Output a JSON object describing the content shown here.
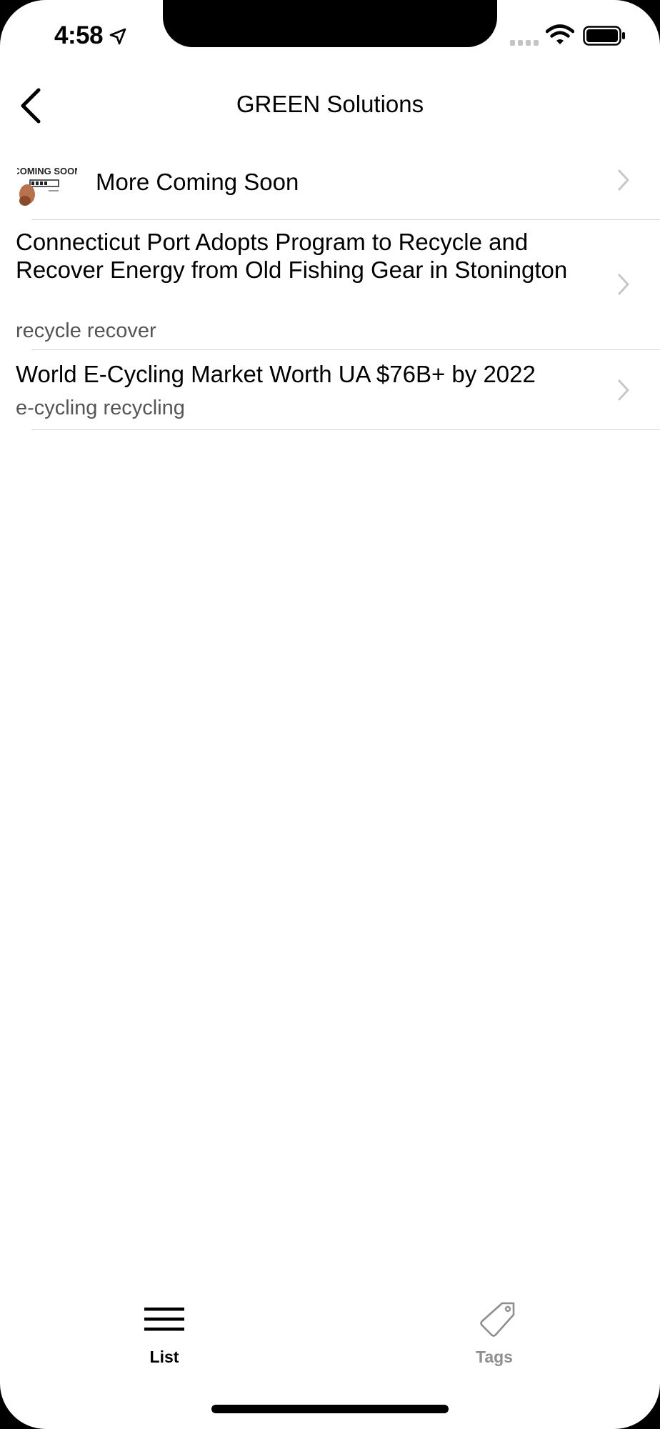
{
  "status_bar": {
    "time": "4:58"
  },
  "nav": {
    "title": "GREEN Solutions"
  },
  "thumbnail": {
    "text": "COMING SOON"
  },
  "list": [
    {
      "title": "More Coming Soon",
      "tags": ""
    },
    {
      "title": "Connecticut Port Adopts Program to Recycle and Recover Energy from Old Fishing Gear in Stonington",
      "tags": "recycle recover"
    },
    {
      "title": "World E-Cycling Market Worth UA $76B+ by 2022",
      "tags": "e-cycling recycling"
    }
  ],
  "tab_bar": {
    "items": [
      {
        "label": "List",
        "icon": "list-icon",
        "selected": true
      },
      {
        "label": "Tags",
        "icon": "tag-icon",
        "selected": false
      }
    ]
  },
  "colors": {
    "background": "#ffffff",
    "text": "#000000",
    "secondary_text": "#555555",
    "separator": "#d6d6d6",
    "chevron": "#c7c7cc",
    "tab_inactive": "#8e8e93"
  }
}
